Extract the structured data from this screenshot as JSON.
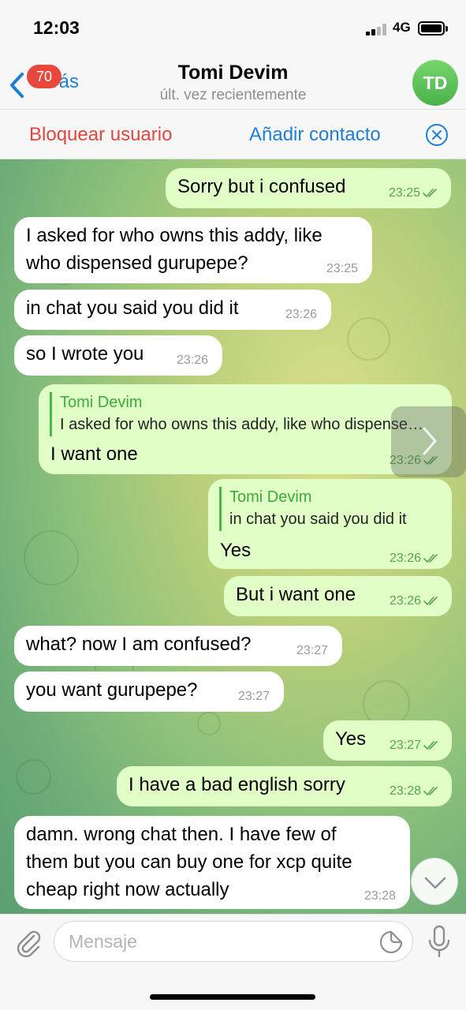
{
  "status_bar": {
    "time": "12:03",
    "network": "4G"
  },
  "nav": {
    "back_label": "Atrás",
    "unread_badge": "70",
    "contact_name": "Tomi Devim",
    "contact_status": "últ. vez recientemente",
    "avatar_initials": "TD",
    "avatar_color": "#5cc257"
  },
  "action_bar": {
    "block_label": "Bloquear usuario",
    "add_label": "Añadir contacto"
  },
  "messages": [
    {
      "dir": "out",
      "text": "Sorry but i confused",
      "time": "23:25",
      "read": true
    },
    {
      "dir": "in",
      "lines": [
        "I asked for who owns this addy, like",
        "who dispensed gurupepe?"
      ],
      "time": "23:25"
    },
    {
      "dir": "in",
      "text": "in chat you said you did it",
      "time": "23:26"
    },
    {
      "dir": "in",
      "text": "so I wrote you",
      "time": "23:26"
    },
    {
      "dir": "out",
      "reply_name": "Tomi Devim",
      "reply_text": "I asked for who owns this addy, like who dispensed gurupepe?",
      "text": "I want one",
      "time": "23:26",
      "read": true
    },
    {
      "dir": "out",
      "reply_name": "Tomi Devim",
      "reply_text": "in chat you said you did it",
      "text": "Yes",
      "time": "23:26",
      "read": true
    },
    {
      "dir": "out",
      "text": "But i want one",
      "time": "23:26",
      "read": true
    },
    {
      "dir": "in",
      "text": "what? now I am confused?",
      "time": "23:27"
    },
    {
      "dir": "in",
      "text": "you want gurupepe?",
      "time": "23:27"
    },
    {
      "dir": "out",
      "text": "Yes",
      "time": "23:27",
      "read": true
    },
    {
      "dir": "out",
      "text": "I have a bad english sorry",
      "time": "23:28",
      "read": true
    },
    {
      "dir": "in",
      "lines": [
        "damn. wrong chat then. I have few of",
        "them but you can buy one for xcp quite",
        "cheap right now actually"
      ],
      "time": "23:28"
    }
  ],
  "composer": {
    "placeholder": "Mensaje"
  },
  "colors": {
    "accent": "#1e7fd6",
    "danger": "#e1463c",
    "outgoing_bubble": "#e1fec6",
    "incoming_bubble": "#ffffff",
    "read_check": "#55a64e"
  },
  "icons": [
    "back-chevron-icon",
    "close-circle-icon",
    "double-check-icon",
    "share-chevron-icon",
    "chevron-down-icon",
    "paperclip-icon",
    "sticker-icon",
    "microphone-icon"
  ]
}
